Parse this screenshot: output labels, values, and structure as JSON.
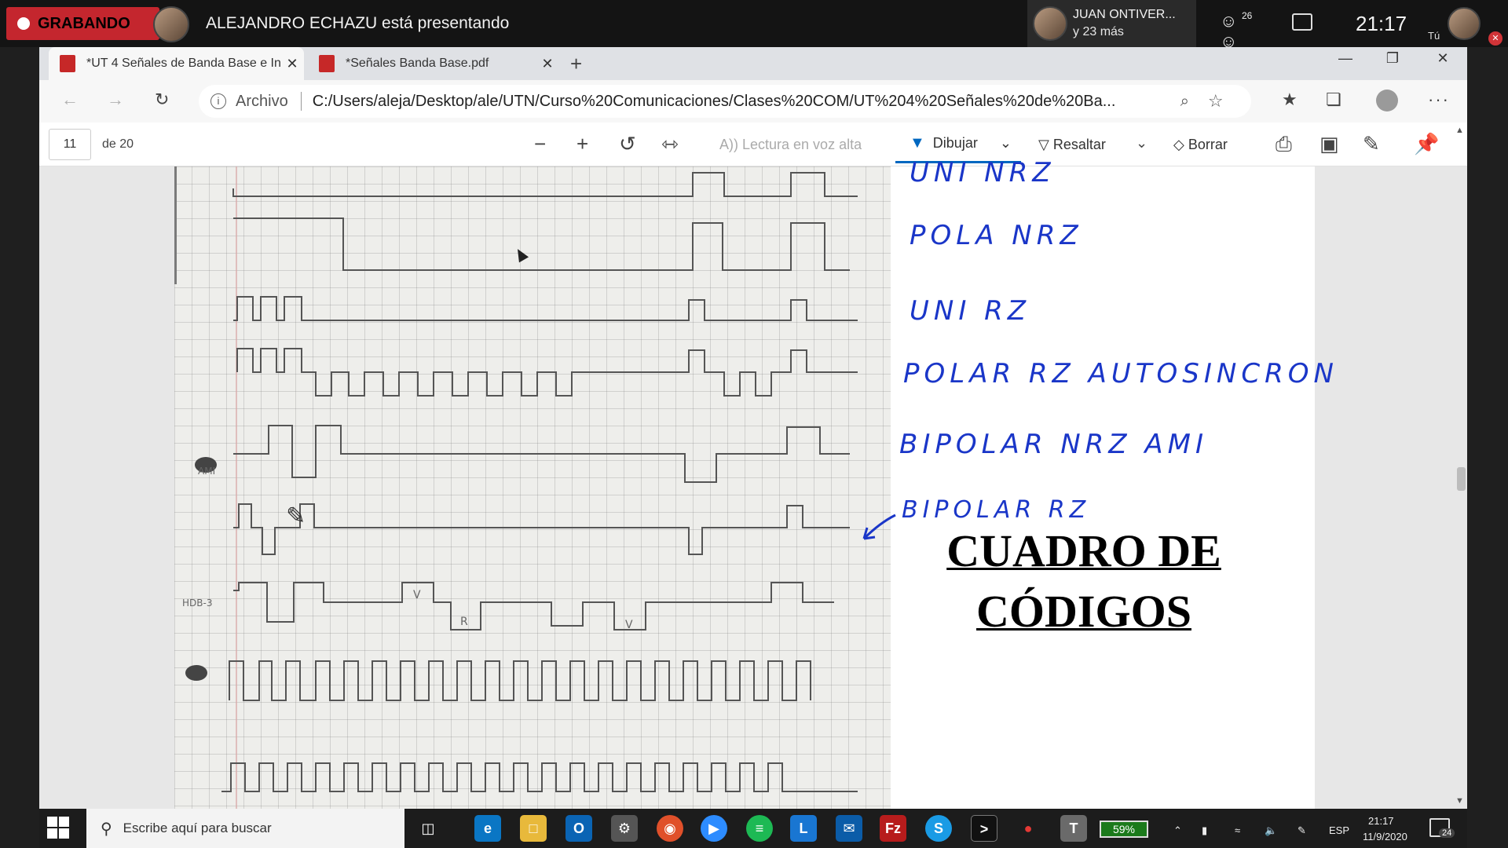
{
  "meeting": {
    "recording_label": "GRABANDO",
    "presenter_text": "ALEJANDRO ECHAZU está presentando",
    "participant_name": "JUAN ONTIVER...",
    "participant_more": "y 23 más",
    "people_count": "26",
    "clock": "21:17",
    "self_label": "Tú"
  },
  "browser": {
    "tabs": [
      {
        "title": "*UT 4 Señales de Banda Base e In",
        "close": "✕"
      },
      {
        "title": "*Señales Banda Base.pdf",
        "close": "✕"
      }
    ],
    "new_tab": "+",
    "window_controls": {
      "minimize": "—",
      "maximize": "❐",
      "close": "✕"
    },
    "address": {
      "scheme_label": "Archivo",
      "url": "C:/Users/aleja/Desktop/ale/UTN/Curso%20Comunicaciones/Clases%20COM/UT%204%20Señales%20de%20Ba..."
    }
  },
  "pdf_toolbar": {
    "page_number": "11",
    "page_of": "de 20",
    "read_aloud": "Lectura en voz alta",
    "draw": "Dibujar",
    "highlight": "Resaltar",
    "erase": "Borrar"
  },
  "document": {
    "handwritten_labels": {
      "uni_nrz": "UNI NRZ",
      "polar_nrz": "POLA NRZ",
      "uni_rz": "UNI RZ",
      "polar_rz": "POLAR RZ AUTOSINCRON",
      "bipolar_nrz": "BIPOLAR NRZ AMI",
      "bipolar_rz": "BIPOLAR RZ"
    },
    "title_line1": "CUADRO DE",
    "title_line2": "CÓDIGOS",
    "photo_row_labels": {
      "hdb3": "HDB-3",
      "ami": "AMI"
    },
    "photo_marks": {
      "v1": "V",
      "r1": "R",
      "v2": "V"
    }
  },
  "taskbar": {
    "search_placeholder": "Escribe aquí para buscar",
    "battery": "59%",
    "language": "ESP",
    "time": "21:17",
    "date": "11/9/2020",
    "notifications": "24"
  },
  "colors": {
    "recording": "#c4262e",
    "ink_blue": "#1a36c8",
    "accent": "#0067c0"
  }
}
